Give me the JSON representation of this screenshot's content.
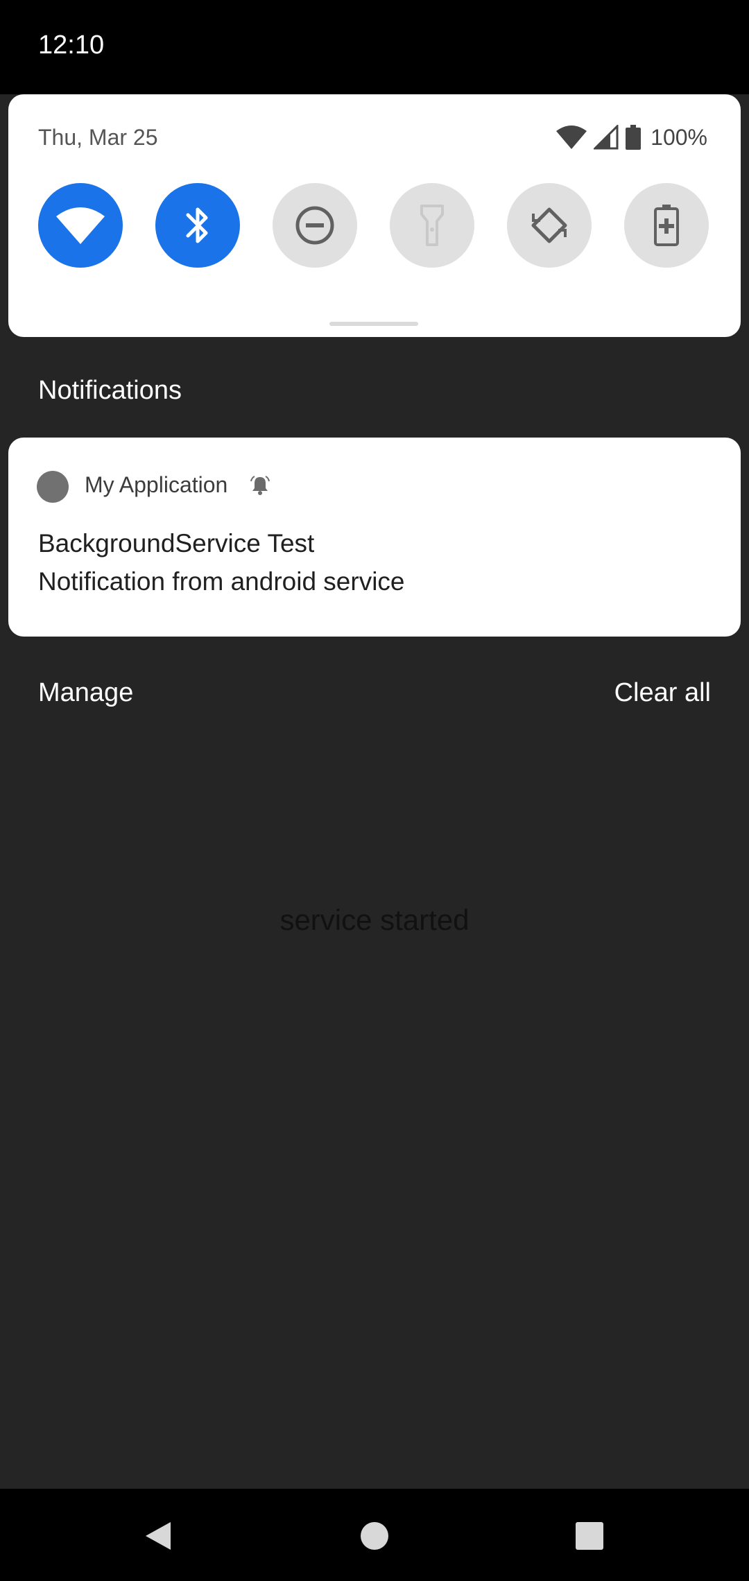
{
  "status_bar": {
    "time": "12:10"
  },
  "quick_settings": {
    "date": "Thu, Mar 25",
    "battery_percent": "100%",
    "accent_color": "#1a73e8",
    "tiles": [
      {
        "name": "wifi",
        "icon": "wifi-icon",
        "state": "on"
      },
      {
        "name": "bluetooth",
        "icon": "bluetooth-icon",
        "state": "on"
      },
      {
        "name": "do-not-disturb",
        "icon": "dnd-icon",
        "state": "off"
      },
      {
        "name": "flashlight",
        "icon": "flashlight-icon",
        "state": "off"
      },
      {
        "name": "auto-rotate",
        "icon": "rotate-icon",
        "state": "off"
      },
      {
        "name": "battery-saver",
        "icon": "battery-saver-icon",
        "state": "off"
      }
    ]
  },
  "notifications": {
    "section_title": "Notifications",
    "items": [
      {
        "app_name": "My Application",
        "title": "BackgroundService Test",
        "text": "Notification from android service"
      }
    ],
    "manage_label": "Manage",
    "clear_all_label": "Clear all"
  },
  "toast": {
    "text": "service started"
  }
}
